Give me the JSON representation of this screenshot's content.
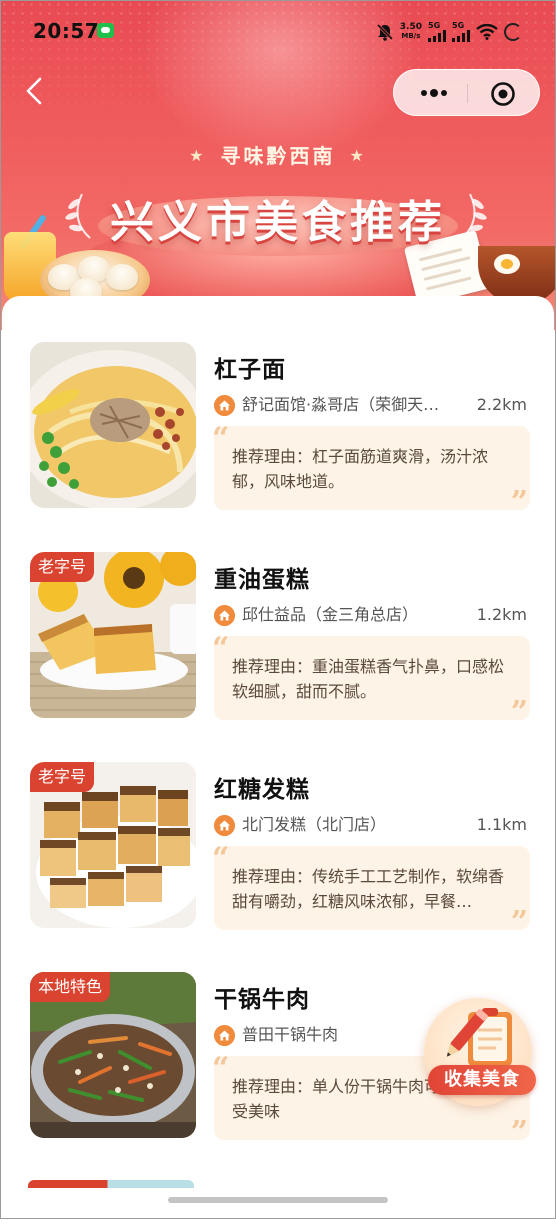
{
  "status_bar": {
    "time": "20:57",
    "net_speed_value": "3.50",
    "net_speed_unit": "MB/s",
    "sim1": "5G",
    "sim2": "5G",
    "icons": [
      "wechat-icon",
      "bell-mute-icon",
      "signal-icon",
      "wifi-icon",
      "battery-icon"
    ]
  },
  "nav": {
    "back_icon": "chevron-left-icon",
    "capsule_icons": [
      "more-icon",
      "close-target-icon"
    ]
  },
  "header": {
    "subtitle": "寻味黔西南",
    "title": "兴义市美食推荐"
  },
  "items": [
    {
      "name": "杠子面",
      "badge": "",
      "shop": "舒记面馆·淼哥店（荣御天…",
      "distance": "2.2km",
      "reason": "推荐理由：杠子面筋道爽滑，汤汁浓郁，风味地道。"
    },
    {
      "name": "重油蛋糕",
      "badge": "老字号",
      "shop": "邱仕益品（金三角总店）",
      "distance": "1.2km",
      "reason": "推荐理由：重油蛋糕香气扑鼻，口感松软细腻，甜而不腻。"
    },
    {
      "name": "红糖发糕",
      "badge": "老字号",
      "shop": "北门发糕（北门店）",
      "distance": "1.1km",
      "reason": "推荐理由：传统手工工艺制作，软绵香甜有嚼劲，红糖风味浓郁，早餐…"
    },
    {
      "name": "干锅牛肉",
      "badge": "本地特色",
      "shop": "普田干锅牛肉",
      "distance": "",
      "reason": "推荐理由：单人份干锅牛肉可以好好享受美味"
    }
  ],
  "fab": {
    "label": "收集美食",
    "icon": "pencil-notepad-icon"
  },
  "colors": {
    "brand_red": "#e84a52",
    "badge_red": "#d9432f",
    "reason_bg": "#fdf3e6",
    "home_orange": "#f08a3c"
  }
}
